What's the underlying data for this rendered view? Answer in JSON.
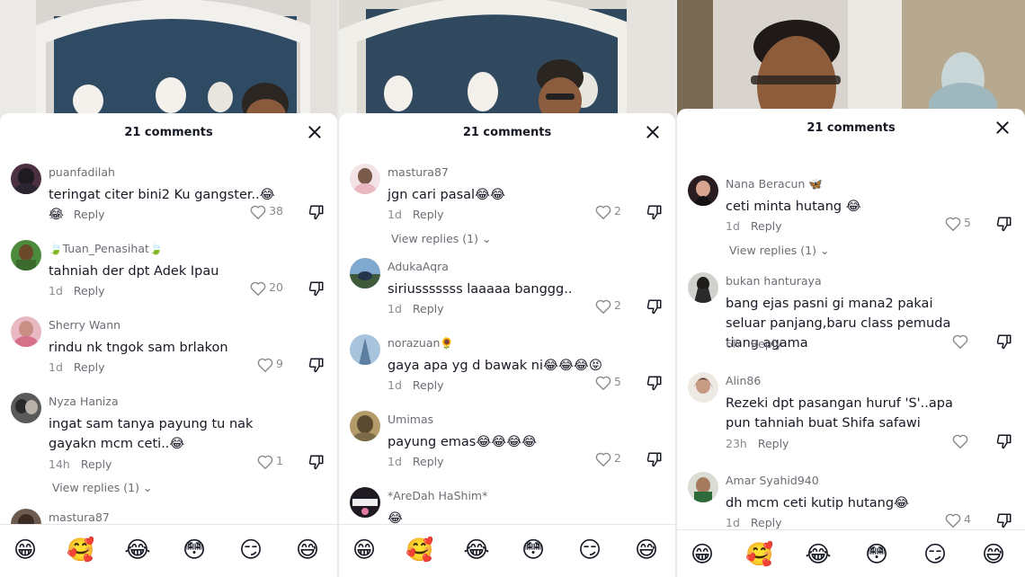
{
  "emojis": [
    "😁",
    "🥰",
    "😂",
    "😳",
    "😏",
    "😅"
  ],
  "panels": [
    {
      "count_label": "21 comments",
      "comments": [
        {
          "user": "puanfadilah",
          "text": "teringat citer bini2 Ku gangster..😂😂",
          "age": "1d",
          "reply": "Reply",
          "likes": "38"
        },
        {
          "user": "🍃Tuan_Penasihat🍃",
          "text": "tahniah der dpt Adek Ipau",
          "age": "1d",
          "reply": "Reply",
          "likes": "20"
        },
        {
          "user": "Sherry Wann",
          "text": "rindu nk tngok sam brlakon",
          "age": "1d",
          "reply": "Reply",
          "likes": "9"
        },
        {
          "user": "Nyza Haniza",
          "text": "ingat sam tanya payung tu nak gayakn mcm ceti..😂",
          "age": "14h",
          "reply": "Reply",
          "likes": "1",
          "view_replies": "View replies (1)"
        },
        {
          "user": "mastura87"
        }
      ]
    },
    {
      "count_label": "21 comments",
      "comments": [
        {
          "user": "mastura87",
          "text": "jgn cari pasal😂😂",
          "age": "1d",
          "reply": "Reply",
          "likes": "2",
          "view_replies": "View replies (1)"
        },
        {
          "user": "AdukaAqra",
          "text": "siriusssssss laaaaa banggg..",
          "age": "1d",
          "reply": "Reply",
          "likes": "2"
        },
        {
          "user": "norazuan🌻",
          "text": "gaya apa yg d bawak ni😂😂😂😝",
          "age": "1d",
          "reply": "Reply",
          "likes": "5"
        },
        {
          "user": "Umimas",
          "text": "payung emas😂😂😂😂",
          "age": "1d",
          "reply": "Reply",
          "likes": "2"
        },
        {
          "user": "*AreDah HaShim*",
          "text": "😂"
        }
      ]
    },
    {
      "count_label": "21 comments",
      "comments": [
        {
          "user": "Nana Beracun 🦋",
          "text": "ceti minta hutang 😂",
          "age": "1d",
          "reply": "Reply",
          "likes": "5",
          "view_replies": "View replies (1)"
        },
        {
          "user": "bukan hanturaya",
          "text": "bang ejas pasni gi mana2 pakai seluar panjang,baru class pemuda tiang agama",
          "age": "6h",
          "reply": "Reply",
          "likes": ""
        },
        {
          "user": "Alin86",
          "text": "Rezeki dpt pasangan huruf 'S'..apa pun tahniah buat Shifa safawi",
          "age": "23h",
          "reply": "Reply",
          "likes": ""
        },
        {
          "user": "Amar Syahid940",
          "text": "dh mcm ceti kutip hutang😂",
          "age": "1d",
          "reply": "Reply",
          "likes": "4"
        }
      ]
    }
  ]
}
